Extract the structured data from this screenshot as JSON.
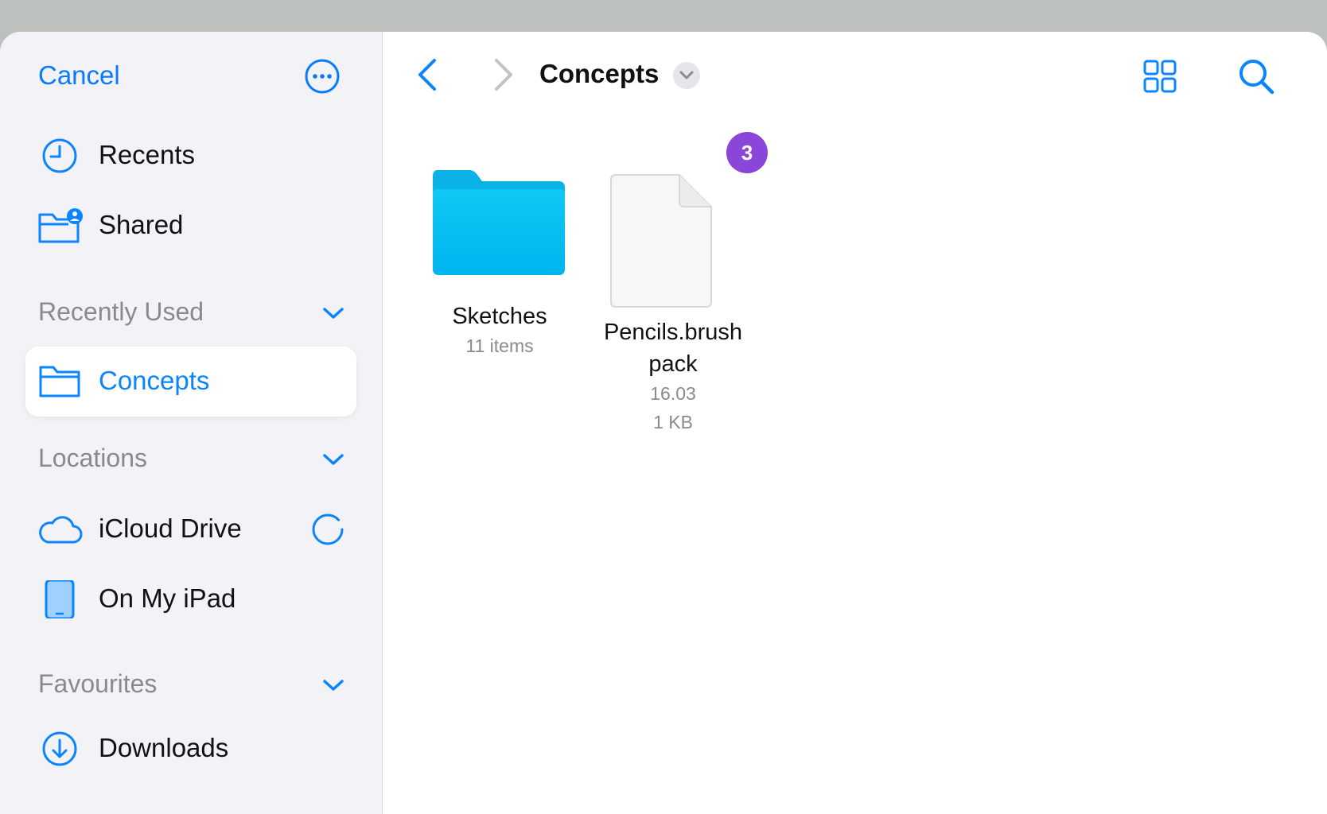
{
  "sidebar": {
    "cancel_label": "Cancel",
    "more_icon": "ellipsis-circle-icon",
    "top_items": [
      {
        "label": "Recents",
        "icon": "clock-icon"
      },
      {
        "label": "Shared",
        "icon": "shared-folder-icon"
      }
    ],
    "sections": {
      "recently_used": {
        "title": "Recently Used",
        "items": [
          {
            "label": "Concepts",
            "icon": "folder-icon",
            "selected": true
          }
        ]
      },
      "locations": {
        "title": "Locations",
        "items": [
          {
            "label": "iCloud Drive",
            "icon": "cloud-icon",
            "status_icon": "sync-progress-icon"
          },
          {
            "label": "On My iPad",
            "icon": "ipad-icon"
          }
        ]
      },
      "favourites": {
        "title": "Favourites",
        "items": [
          {
            "label": "Downloads",
            "icon": "download-circle-icon"
          }
        ]
      }
    }
  },
  "toolbar": {
    "back_icon": "chevron-left-icon",
    "forward_icon": "chevron-right-icon",
    "title": "Concepts",
    "title_dropdown_icon": "chevron-down-icon",
    "view_icon": "grid-view-icon",
    "search_icon": "search-icon"
  },
  "files": [
    {
      "name": "Sketches",
      "meta": [
        "11 items"
      ],
      "type": "folder"
    },
    {
      "name_lines": [
        "Pencils.brush",
        "pack"
      ],
      "meta": [
        "16.03",
        "1 KB"
      ],
      "type": "document",
      "badge": "3"
    }
  ],
  "colors": {
    "accent": "#0a84ff",
    "folder": "#00c0f0",
    "badge": "#8b45d8",
    "sidebar_bg": "#f2f2f7"
  }
}
